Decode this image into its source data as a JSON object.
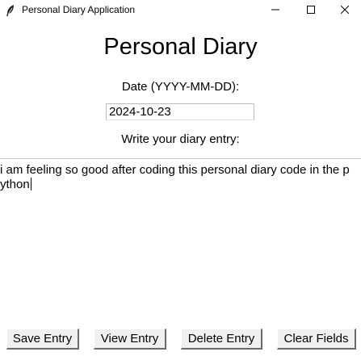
{
  "window": {
    "title": "Personal Diary Application",
    "icon": "feather-icon",
    "controls": [
      "minimize-icon",
      "maximize-icon",
      "close-icon"
    ]
  },
  "main": {
    "heading": "Personal Diary",
    "date_label": "Date (YYYY-MM-DD):",
    "date_value": "2024-10-23",
    "entry_label": "Write your diary entry:",
    "entry_line1": "i am feeling so good after coding this personal diary code in the p",
    "entry_line2": "ython"
  },
  "buttons": {
    "save": "Save Entry",
    "view": "View Entry",
    "delete": "Delete Entry",
    "clear": "Clear Fields"
  },
  "colors": {
    "background": "#ffffff",
    "button_face": "#f0f0f0",
    "button_shadow": "#6a6a6a"
  }
}
